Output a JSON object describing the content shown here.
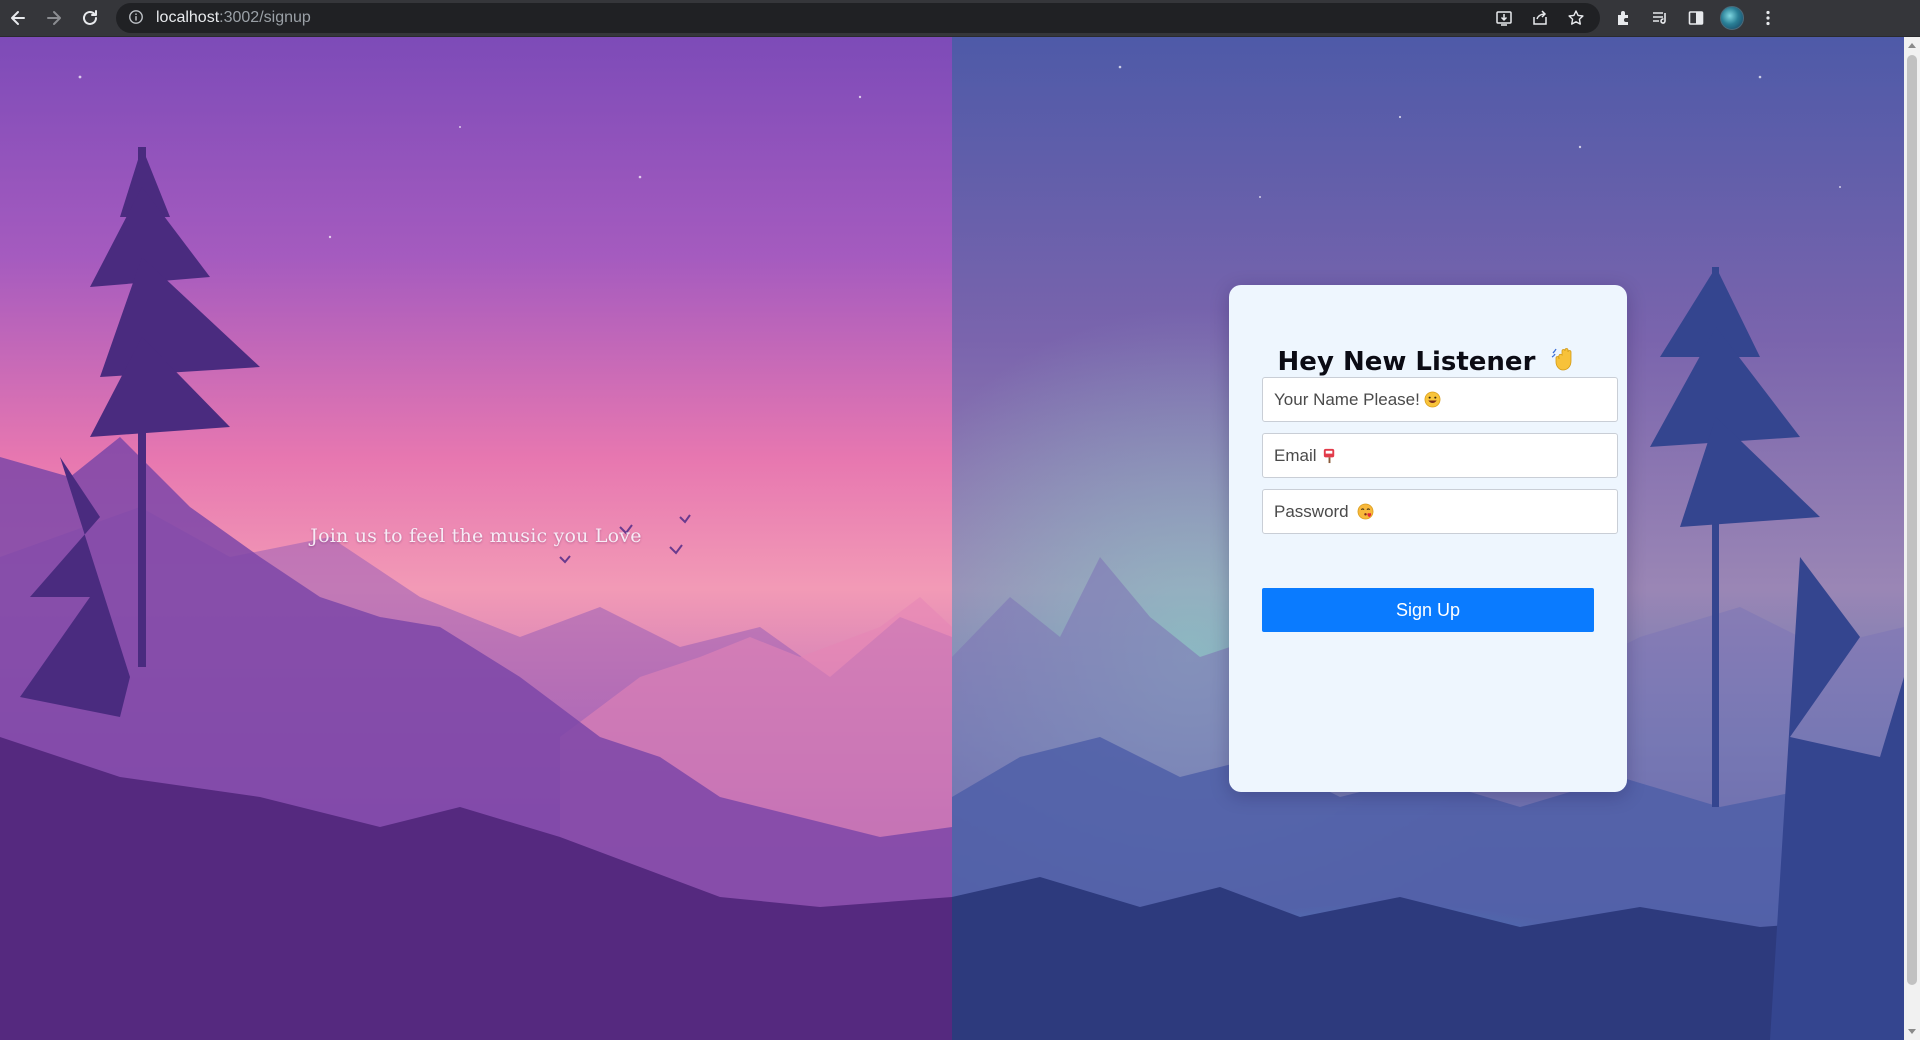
{
  "browser": {
    "url_host": "localhost",
    "url_path": ":3002/signup",
    "icons": [
      "back-icon",
      "forward-icon",
      "reload-icon",
      "info-icon",
      "install-icon",
      "share-icon",
      "star-icon",
      "extensions-icon",
      "media-icon",
      "side-panel-icon",
      "profile-avatar",
      "menu-icon"
    ]
  },
  "hero": {
    "tagline": "Join us to feel the music you Love"
  },
  "signup": {
    "title": "Hey New Listener",
    "title_emoji": "waving-hand-icon",
    "name_placeholder": "Your Name Please!",
    "name_emoji": "grinning-face-icon",
    "email_placeholder": "Email",
    "email_emoji": "mailbox-icon",
    "password_placeholder": "Password",
    "password_emoji": "face-blowing-kiss-icon",
    "submit_label": "Sign Up"
  },
  "colors": {
    "button": "#0a7bff",
    "card_background": "#eef6fe",
    "chrome_background": "#35363a"
  }
}
